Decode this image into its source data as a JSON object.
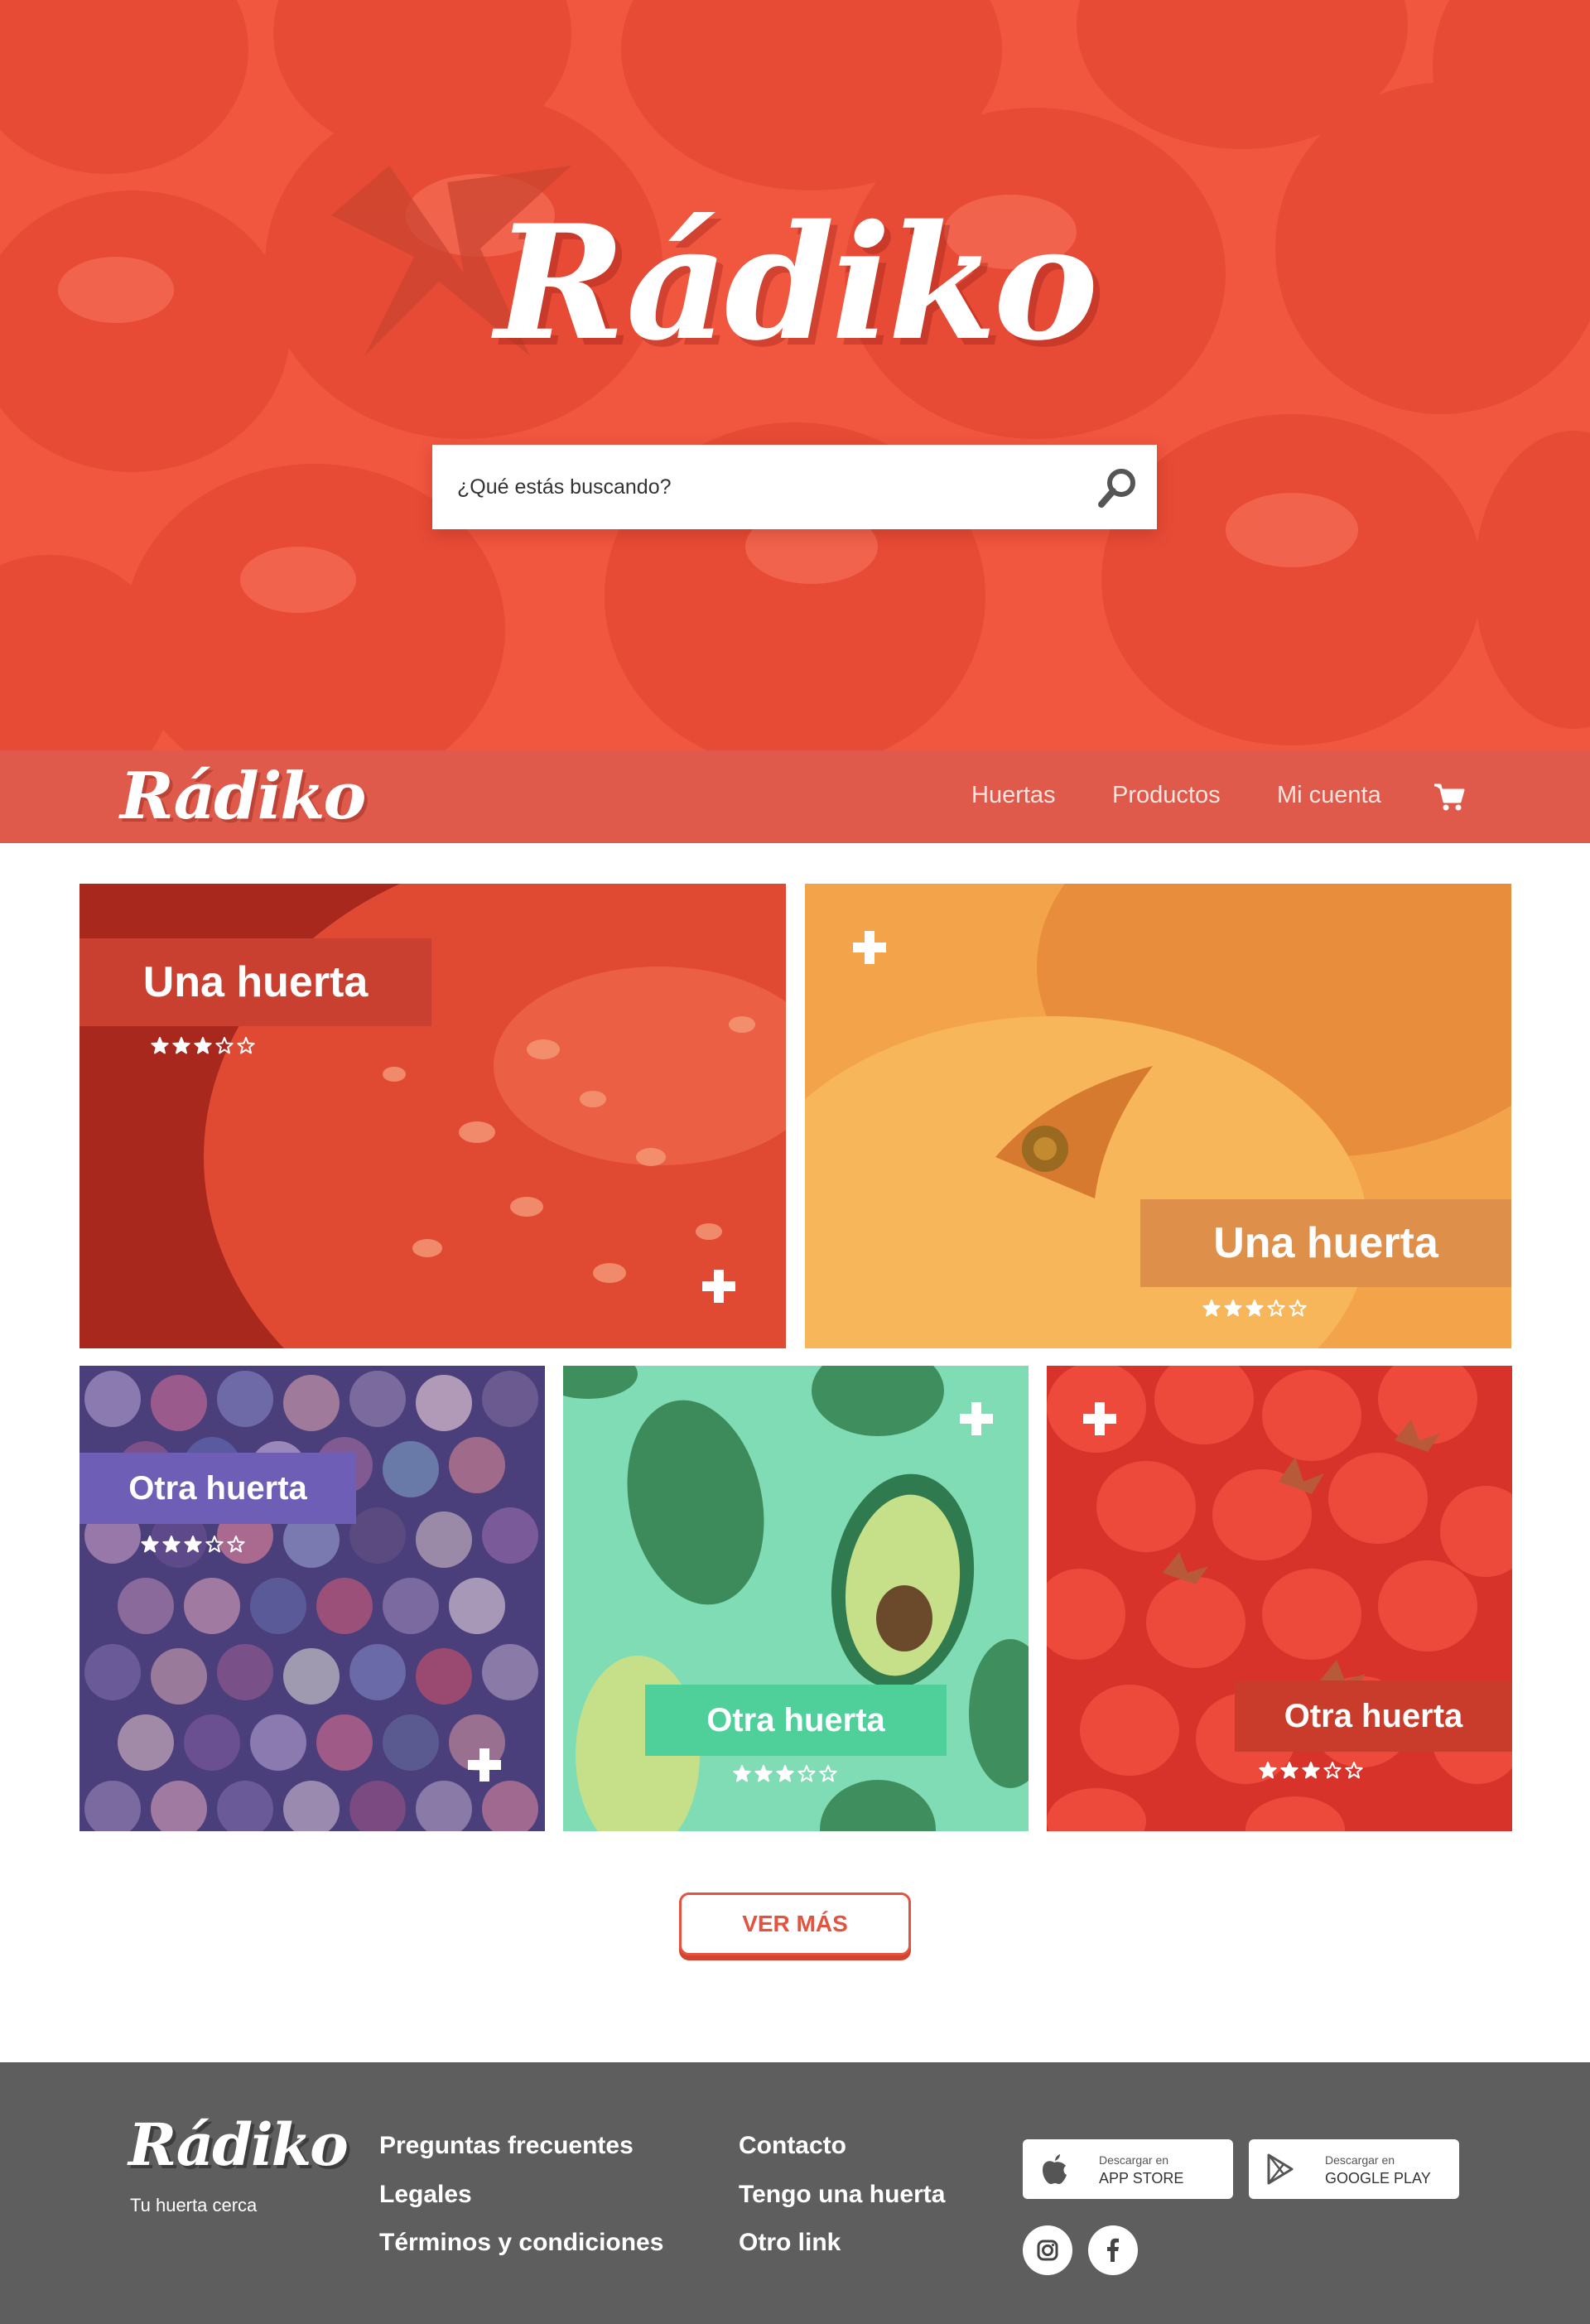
{
  "hero": {
    "logo": "Rádiko",
    "search_placeholder": "¿Qué estás buscando?",
    "search_icon": "search-icon"
  },
  "nav": {
    "logo": "Rádiko",
    "links": [
      "Huertas",
      "Productos",
      "Mi cuenta"
    ],
    "cart_icon": "cart-icon"
  },
  "cards": [
    {
      "title": "Una huerta",
      "rating": 3,
      "max": 5,
      "accent": "#c94030",
      "theme": "tomato"
    },
    {
      "title": "Una huerta",
      "rating": 3,
      "max": 5,
      "accent": "#de8f4a",
      "theme": "peach"
    },
    {
      "title": "Otra huerta",
      "rating": 3,
      "max": 5,
      "accent": "#6e5eb5",
      "theme": "spices"
    },
    {
      "title": "Otra huerta",
      "rating": 3,
      "max": 5,
      "accent": "#4fcf9a",
      "theme": "avocado"
    },
    {
      "title": "Otra huerta",
      "rating": 3,
      "max": 5,
      "accent": "#c93c2c",
      "theme": "strawberry"
    }
  ],
  "ver_mas": "VER MÁS",
  "footer": {
    "logo": "Rádiko",
    "tagline": "Tu huerta cerca",
    "col1": [
      "Preguntas frecuentes",
      "Legales",
      "Términos y condiciones"
    ],
    "col2": [
      "Contacto",
      "Tengo una huerta",
      "Otro link"
    ],
    "stores": [
      {
        "small": "Descargar en",
        "big": "APP STORE",
        "icon": "apple-icon"
      },
      {
        "small": "Descargar en",
        "big": "GOOGLE PLAY",
        "icon": "play-store-icon"
      }
    ],
    "social": [
      "instagram-icon",
      "facebook-icon"
    ]
  },
  "colors": {
    "brand": "#f1563f",
    "nav": "#df5a4a",
    "footer": "#5e5e5e",
    "button": "#e3533f"
  }
}
